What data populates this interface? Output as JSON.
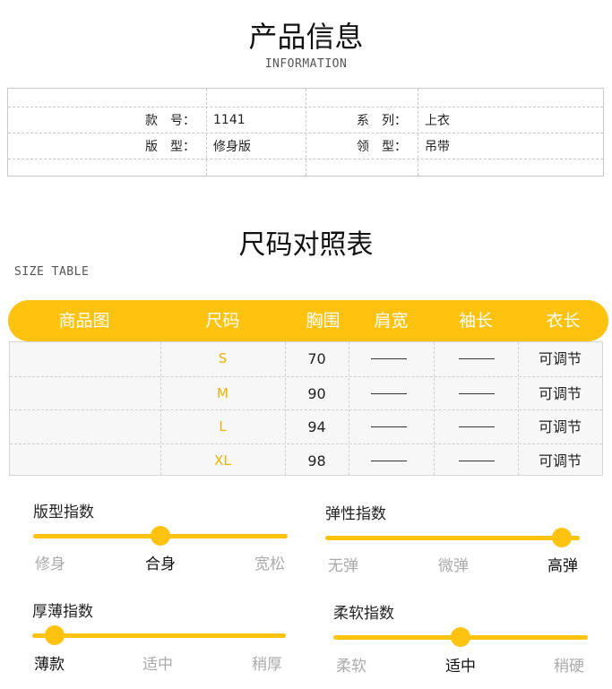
{
  "product_info": {
    "title": "产品信息",
    "subtitle": "INFORMATION",
    "rows": [
      {
        "label1": "款　号：",
        "value1": "1141",
        "label2": "系　列：",
        "value2": "上衣"
      },
      {
        "label1": "版　型：",
        "value1": "修身版",
        "label2": "领　型：",
        "value2": "吊带"
      }
    ]
  },
  "size_table": {
    "title": "尺码对照表",
    "subtitle": "SIZE TABLE",
    "headers": [
      "商品图",
      "尺码",
      "胸围",
      "肩宽",
      "袖长",
      "衣长"
    ],
    "rows": [
      {
        "size": "S",
        "chest": "70",
        "length": "可调节"
      },
      {
        "size": "M",
        "chest": "90",
        "length": "可调节"
      },
      {
        "size": "L",
        "chest": "94",
        "length": "可调节"
      },
      {
        "size": "XL",
        "chest": "98",
        "length": "可调节"
      }
    ]
  },
  "indices": [
    {
      "title": "版型指数",
      "labels": [
        "修身",
        "合身",
        "宽松"
      ],
      "selected": 1,
      "level": 0.5
    },
    {
      "title": "弹性指数",
      "labels": [
        "无弹",
        "微弹",
        "高弹"
      ],
      "selected": 2,
      "level": 0.93
    },
    {
      "title": "厚薄指数",
      "labels": [
        "薄款",
        "适中",
        "稍厚"
      ],
      "selected": 0,
      "level": 0.09
    },
    {
      "title": "柔软指数",
      "labels": [
        "柔软",
        "适中",
        "稍硬"
      ],
      "selected": 1,
      "level": 0.5
    }
  ],
  "colors": {
    "accent": "#ffc20e",
    "size_letter": "#f0b400",
    "inactive": "#aaaaaa"
  }
}
